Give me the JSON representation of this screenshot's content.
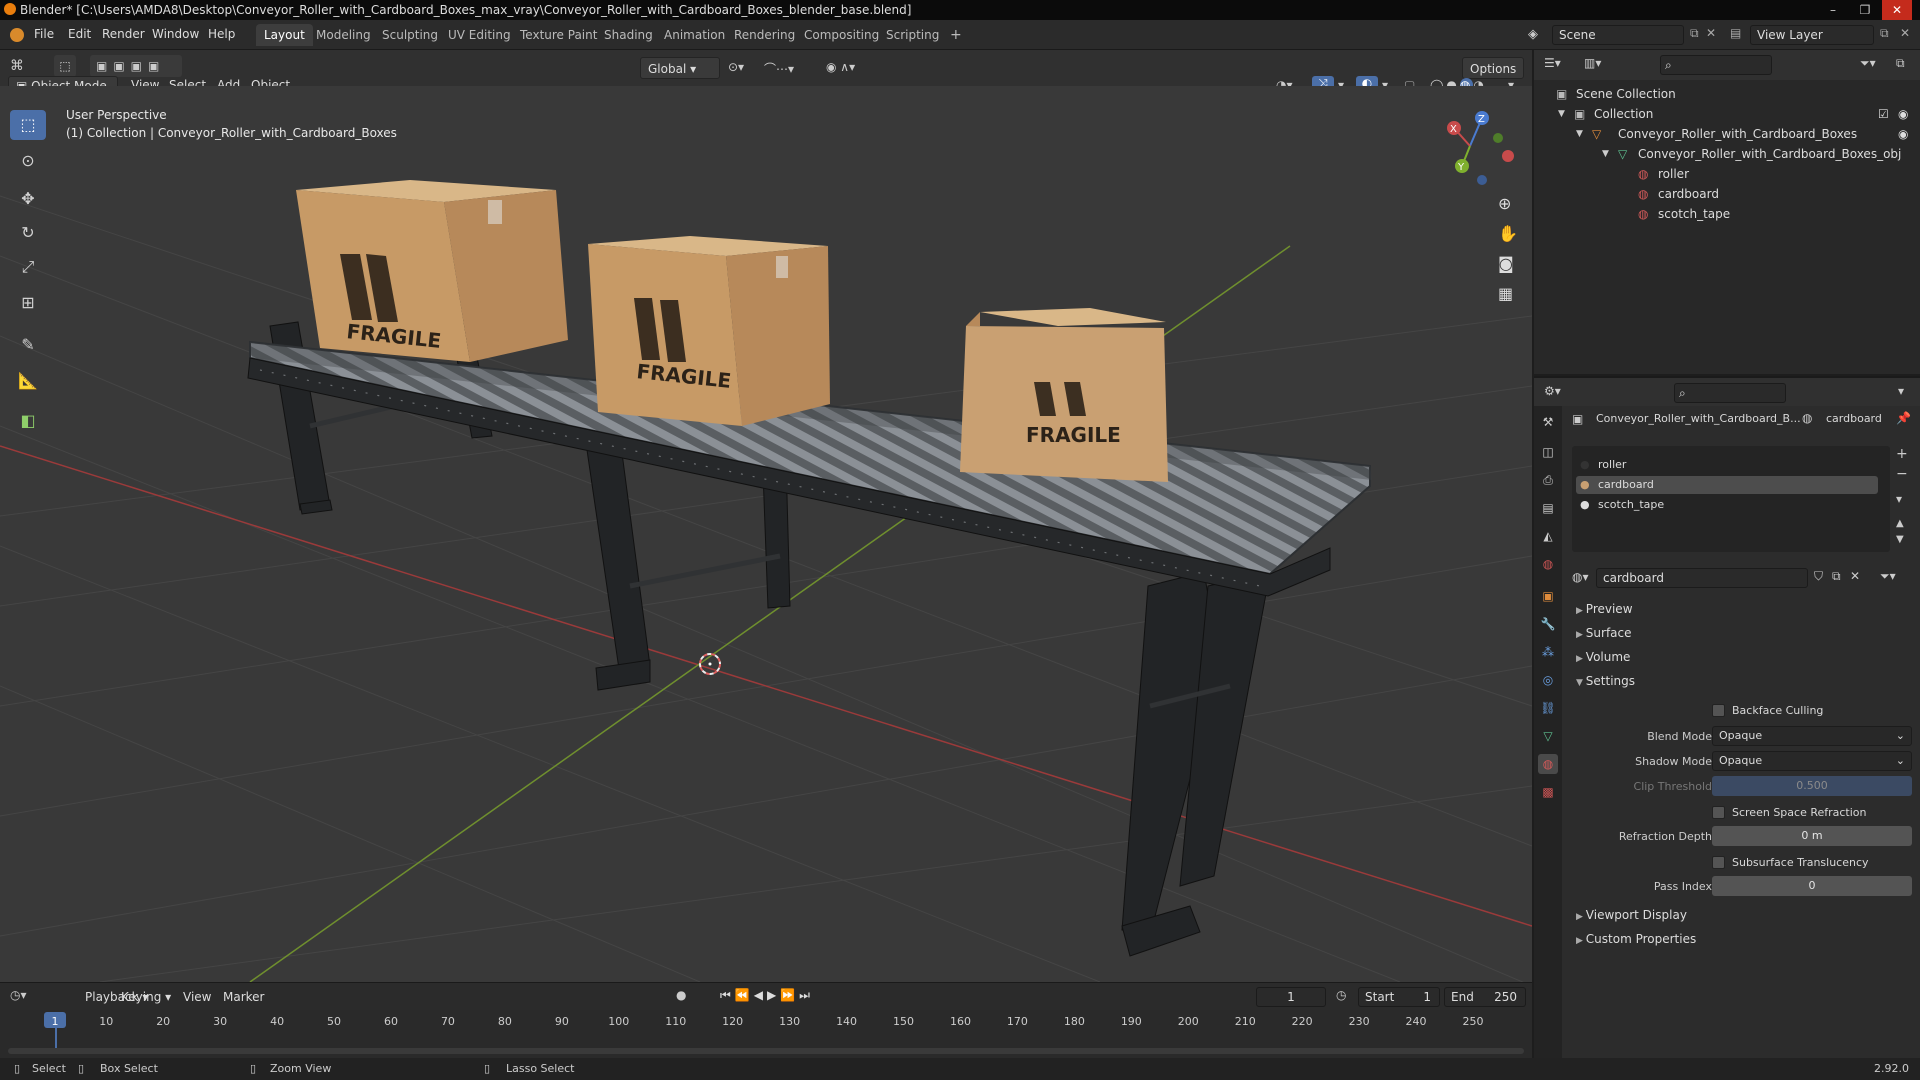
{
  "window": {
    "title": "Blender* [C:\\Users\\AMDA8\\Desktop\\Conveyor_Roller_with_Cardboard_Boxes_max_vray\\Conveyor_Roller_with_Cardboard_Boxes_blender_base.blend]",
    "minimize": "–",
    "maximize": "❐",
    "close": "✕"
  },
  "menu": {
    "file": "File",
    "edit": "Edit",
    "render": "Render",
    "window": "Window",
    "help": "Help"
  },
  "workspaces": [
    "Layout",
    "Modeling",
    "Sculpting",
    "UV Editing",
    "Texture Paint",
    "Shading",
    "Animation",
    "Rendering",
    "Compositing",
    "Scripting"
  ],
  "workspace_add": "+",
  "scene": {
    "name": "Scene",
    "view_layer": "View Layer"
  },
  "viewport_header": {
    "mode": "Object Mode",
    "view": "View",
    "select": "Select",
    "add": "Add",
    "object": "Object",
    "transform": "Global",
    "options": "Options"
  },
  "viewport": {
    "perspective": "User Perspective",
    "collection_info": "(1) Collection | Conveyor_Roller_with_Cardboard_Boxes",
    "box_label": "FRAGILE",
    "box_label_2": "FRAGILE",
    "box_label_3": "FRAGILE",
    "gizmo_x": "X",
    "gizmo_y": "Y",
    "gizmo_z": "Z"
  },
  "timeline": {
    "playback": "Playback",
    "keying": "Keying",
    "view": "View",
    "marker": "Marker",
    "current_frame": "1",
    "start_label": "Start",
    "start": "1",
    "end_label": "End",
    "end": "250",
    "ticks": [
      "1",
      "10",
      "20",
      "30",
      "40",
      "50",
      "60",
      "70",
      "80",
      "90",
      "100",
      "110",
      "120",
      "130",
      "140",
      "150",
      "160",
      "170",
      "180",
      "190",
      "200",
      "210",
      "220",
      "230",
      "240",
      "250"
    ]
  },
  "statusbar": {
    "select": "Select",
    "box_select": "Box Select",
    "zoom_view": "Zoom View",
    "lasso_select": "Lasso Select",
    "version": "2.92.0"
  },
  "outliner": {
    "scene_collection": "Scene Collection",
    "collection": "Collection",
    "object": "Conveyor_Roller_with_Cardboard_Boxes",
    "mesh": "Conveyor_Roller_with_Cardboard_Boxes_obj",
    "materials": [
      "roller",
      "cardboard",
      "scotch_tape"
    ]
  },
  "properties": {
    "breadcrumb_object": "Conveyor_Roller_with_Cardboard_B...",
    "breadcrumb_material": "cardboard",
    "slots": [
      "roller",
      "cardboard",
      "scotch_tape"
    ],
    "selected_slot": 1,
    "material_name": "cardboard",
    "panels": {
      "preview": "Preview",
      "surface": "Surface",
      "volume": "Volume",
      "settings": "Settings",
      "viewport_display": "Viewport Display",
      "custom_properties": "Custom Properties"
    },
    "settings": {
      "backface_culling": "Backface Culling",
      "blend_mode_label": "Blend Mode",
      "blend_mode": "Opaque",
      "shadow_mode_label": "Shadow Mode",
      "shadow_mode": "Opaque",
      "clip_threshold_label": "Clip Threshold",
      "clip_threshold": "0.500",
      "ssr_label": "Screen Space Refraction",
      "refraction_depth_label": "Refraction Depth",
      "refraction_depth": "0 m",
      "sss_label": "Subsurface Translucency",
      "pass_index_label": "Pass Index",
      "pass_index": "0"
    }
  },
  "colors": {
    "accent": "#4b6fa8",
    "viewport_bg": "#393939",
    "grid_x": "#9b3a3a",
    "grid_y": "#6f8f2e",
    "box": "#c9a072"
  }
}
